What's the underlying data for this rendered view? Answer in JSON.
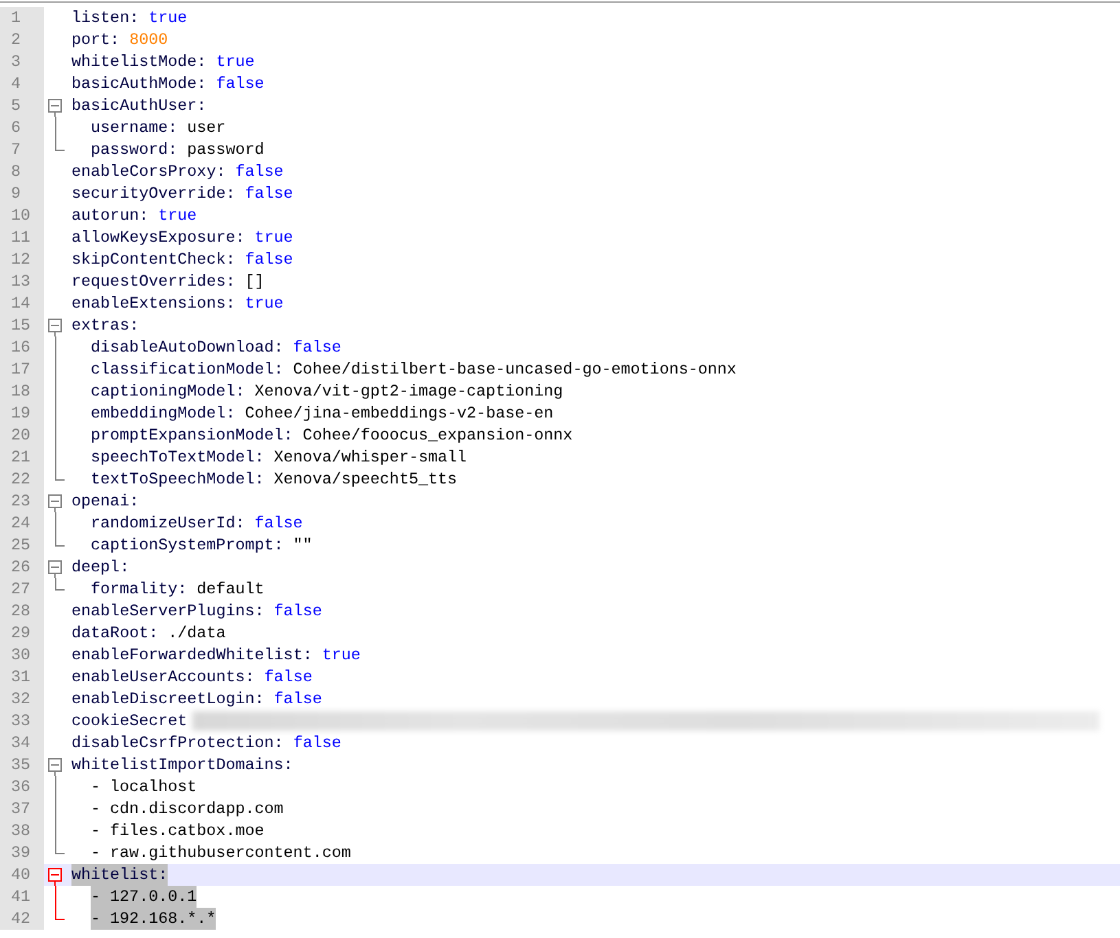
{
  "editor": {
    "lines": [
      {
        "number": "1",
        "kind": "pair",
        "key": "listen:",
        "value": {
          "kind": "bool",
          "text": "true"
        },
        "selected": false,
        "current": false
      },
      {
        "number": "2",
        "kind": "pair",
        "key": "port:",
        "value": {
          "kind": "number",
          "text": "8000"
        },
        "selected": false,
        "current": false
      },
      {
        "number": "3",
        "kind": "pair",
        "key": "whitelistMode:",
        "value": {
          "kind": "bool",
          "text": "true"
        },
        "selected": false,
        "current": false
      },
      {
        "number": "4",
        "kind": "pair",
        "key": "basicAuthMode:",
        "value": {
          "kind": "bool",
          "text": "false"
        },
        "selected": false,
        "current": false
      },
      {
        "number": "5",
        "kind": "pair",
        "key": "basicAuthUser:",
        "expanded": true,
        "selected": false,
        "current": false,
        "children": [
          {
            "number": "6",
            "kind": "pair",
            "key": "username:",
            "value": {
              "kind": "plain",
              "text": "user"
            },
            "selected": false,
            "current": false
          },
          {
            "number": "7",
            "kind": "pair",
            "key": "password:",
            "value": {
              "kind": "plain",
              "text": "password"
            },
            "selected": false,
            "current": false
          }
        ]
      },
      {
        "number": "8",
        "kind": "pair",
        "key": "enableCorsProxy:",
        "value": {
          "kind": "bool",
          "text": "false"
        },
        "selected": false,
        "current": false
      },
      {
        "number": "9",
        "kind": "pair",
        "key": "securityOverride:",
        "value": {
          "kind": "bool",
          "text": "false"
        },
        "selected": false,
        "current": false
      },
      {
        "number": "10",
        "kind": "pair",
        "key": "autorun:",
        "value": {
          "kind": "bool",
          "text": "true"
        },
        "selected": false,
        "current": false
      },
      {
        "number": "11",
        "kind": "pair",
        "key": "allowKeysExposure:",
        "value": {
          "kind": "bool",
          "text": "true"
        },
        "selected": false,
        "current": false
      },
      {
        "number": "12",
        "kind": "pair",
        "key": "skipContentCheck:",
        "value": {
          "kind": "bool",
          "text": "false"
        },
        "selected": false,
        "current": false
      },
      {
        "number": "13",
        "kind": "pair",
        "key": "requestOverrides:",
        "value": {
          "kind": "plain",
          "text": "[]"
        },
        "selected": false,
        "current": false
      },
      {
        "number": "14",
        "kind": "pair",
        "key": "enableExtensions:",
        "value": {
          "kind": "bool",
          "text": "true"
        },
        "selected": false,
        "current": false
      },
      {
        "number": "15",
        "kind": "pair",
        "key": "extras:",
        "expanded": true,
        "selected": false,
        "current": false,
        "children": [
          {
            "number": "16",
            "kind": "pair",
            "key": "disableAutoDownload:",
            "value": {
              "kind": "bool",
              "text": "false"
            },
            "selected": false,
            "current": false
          },
          {
            "number": "17",
            "kind": "pair",
            "key": "classificationModel:",
            "value": {
              "kind": "plain",
              "text": "Cohee/distilbert-base-uncased-go-emotions-onnx"
            },
            "selected": false,
            "current": false
          },
          {
            "number": "18",
            "kind": "pair",
            "key": "captioningModel:",
            "value": {
              "kind": "plain",
              "text": "Xenova/vit-gpt2-image-captioning"
            },
            "selected": false,
            "current": false
          },
          {
            "number": "19",
            "kind": "pair",
            "key": "embeddingModel:",
            "value": {
              "kind": "plain",
              "text": "Cohee/jina-embeddings-v2-base-en"
            },
            "selected": false,
            "current": false
          },
          {
            "number": "20",
            "kind": "pair",
            "key": "promptExpansionModel:",
            "value": {
              "kind": "plain",
              "text": "Cohee/fooocus_expansion-onnx"
            },
            "selected": false,
            "current": false
          },
          {
            "number": "21",
            "kind": "pair",
            "key": "speechToTextModel:",
            "value": {
              "kind": "plain",
              "text": "Xenova/whisper-small"
            },
            "selected": false,
            "current": false
          },
          {
            "number": "22",
            "kind": "pair",
            "key": "textToSpeechModel:",
            "value": {
              "kind": "plain",
              "text": "Xenova/speecht5_tts"
            },
            "selected": false,
            "current": false
          }
        ]
      },
      {
        "number": "23",
        "kind": "pair",
        "key": "openai:",
        "expanded": true,
        "selected": false,
        "current": false,
        "children": [
          {
            "number": "24",
            "kind": "pair",
            "key": "randomizeUserId:",
            "value": {
              "kind": "bool",
              "text": "false"
            },
            "selected": false,
            "current": false
          },
          {
            "number": "25",
            "kind": "pair",
            "key": "captionSystemPrompt:",
            "value": {
              "kind": "plain",
              "text": "\"\""
            },
            "selected": false,
            "current": false
          }
        ]
      },
      {
        "number": "26",
        "kind": "pair",
        "key": "deepl:",
        "expanded": true,
        "selected": false,
        "current": false,
        "children": [
          {
            "number": "27",
            "kind": "pair",
            "key": "formality:",
            "value": {
              "kind": "plain",
              "text": "default"
            },
            "selected": false,
            "current": false
          }
        ]
      },
      {
        "number": "28",
        "kind": "pair",
        "key": "enableServerPlugins:",
        "value": {
          "kind": "bool",
          "text": "false"
        },
        "selected": false,
        "current": false
      },
      {
        "number": "29",
        "kind": "pair",
        "key": "dataRoot:",
        "value": {
          "kind": "plain",
          "text": "./data"
        },
        "selected": false,
        "current": false
      },
      {
        "number": "30",
        "kind": "pair",
        "key": "enableForwardedWhitelist:",
        "value": {
          "kind": "bool",
          "text": "true"
        },
        "selected": false,
        "current": false
      },
      {
        "number": "31",
        "kind": "pair",
        "key": "enableUserAccounts:",
        "value": {
          "kind": "bool",
          "text": "false"
        },
        "selected": false,
        "current": false
      },
      {
        "number": "32",
        "kind": "pair",
        "key": "enableDiscreetLogin:",
        "value": {
          "kind": "bool",
          "text": "false"
        },
        "selected": false,
        "current": false
      },
      {
        "number": "33",
        "kind": "pair",
        "key": "cookieSecret",
        "redacted": true,
        "selected": false,
        "current": false
      },
      {
        "number": "34",
        "kind": "pair",
        "key": "disableCsrfProtection:",
        "value": {
          "kind": "bool",
          "text": "false"
        },
        "selected": false,
        "current": false
      },
      {
        "number": "35",
        "kind": "pair",
        "key": "whitelistImportDomains:",
        "expanded": true,
        "selected": false,
        "current": false,
        "children": [
          {
            "number": "36",
            "kind": "entry",
            "text": "- localhost",
            "selected": false,
            "current": false
          },
          {
            "number": "37",
            "kind": "entry",
            "text": "- cdn.discordapp.com",
            "selected": false,
            "current": false
          },
          {
            "number": "38",
            "kind": "entry",
            "text": "- files.catbox.moe",
            "selected": false,
            "current": false
          },
          {
            "number": "39",
            "kind": "entry",
            "text": "- raw.githubusercontent.com",
            "selected": false,
            "current": false
          }
        ]
      },
      {
        "number": "40",
        "kind": "pair",
        "key": "whitelist:",
        "expanded": true,
        "selected": true,
        "current": true,
        "children": [
          {
            "number": "41",
            "kind": "entry",
            "text": "- 127.0.0.1",
            "selected": true,
            "current": false
          },
          {
            "number": "42",
            "kind": "entry",
            "text": "- 192.168.*.*",
            "selected": true,
            "current": false
          }
        ]
      }
    ]
  }
}
